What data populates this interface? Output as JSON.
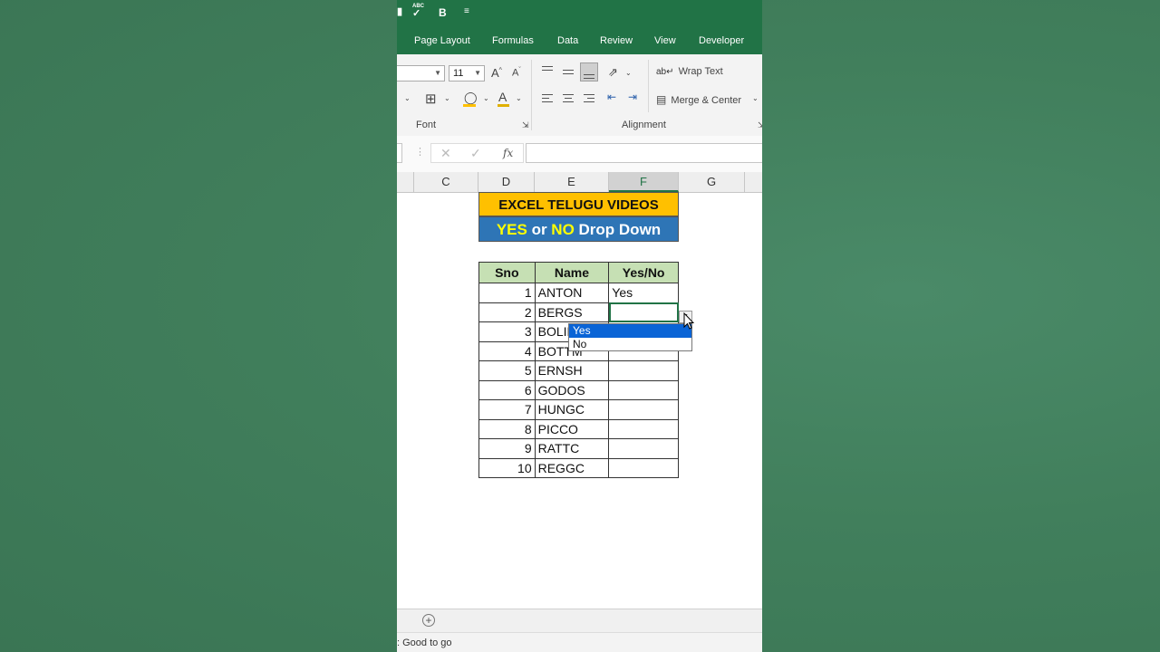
{
  "qat": {
    "spell_label": "ABC",
    "bold_label": "B"
  },
  "tabs": [
    "Page Layout",
    "Formulas",
    "Data",
    "Review",
    "View",
    "Developer"
  ],
  "ribbon": {
    "font_size": "11",
    "wrap_text": "Wrap Text",
    "merge_center": "Merge & Center",
    "group_font": "Font",
    "group_alignment": "Alignment",
    "fx_label": "fx"
  },
  "columns": [
    "C",
    "D",
    "E",
    "F",
    "G"
  ],
  "selected_column": "F",
  "banner": {
    "title": "EXCEL TELUGU VIDEOS",
    "sub_yes": "YES",
    "sub_or": " or ",
    "sub_no": "NO",
    "sub_rest": " Drop Down"
  },
  "table": {
    "headers": [
      "Sno",
      "Name",
      "Yes/No"
    ],
    "rows": [
      {
        "sno": "1",
        "name": "ANTON",
        "yn": "Yes"
      },
      {
        "sno": "2",
        "name": "BERGS",
        "yn": ""
      },
      {
        "sno": "3",
        "name": "BOLID",
        "yn": ""
      },
      {
        "sno": "4",
        "name": "BOTTM",
        "yn": ""
      },
      {
        "sno": "5",
        "name": "ERNSH",
        "yn": ""
      },
      {
        "sno": "6",
        "name": "GODOS",
        "yn": ""
      },
      {
        "sno": "7",
        "name": "HUNGC",
        "yn": ""
      },
      {
        "sno": "8",
        "name": "PICCO",
        "yn": ""
      },
      {
        "sno": "9",
        "name": "RATTC",
        "yn": ""
      },
      {
        "sno": "10",
        "name": "REGGC",
        "yn": ""
      }
    ]
  },
  "dropdown": {
    "options": [
      "Yes",
      "No"
    ],
    "highlighted": "Yes"
  },
  "status": {
    "text": ": Good to go"
  },
  "colors": {
    "excel_green": "#217346",
    "banner_title_bg": "#ffc000",
    "banner_sub_bg": "#2e75b6",
    "banner_yes_no": "#ffff00",
    "header_fill": "#c6e0b4",
    "dropdown_highlight": "#0a64d6"
  }
}
